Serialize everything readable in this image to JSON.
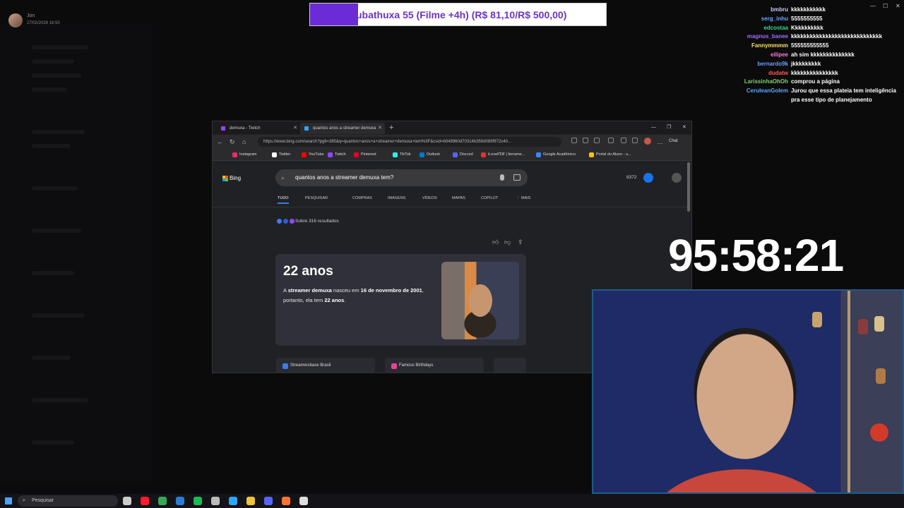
{
  "overlay": {
    "streamer_name": "Jon",
    "datetime": "27/02/2026 16:50",
    "sub_goal": {
      "label": "Subathuxa 55 (Filme +4h) (R$ 81,10/R$ 500,00)",
      "progress_fraction": 0.162,
      "fill_color": "#6b2bd6"
    },
    "timer": "95:58:21"
  },
  "chat": [
    {
      "user": "bmbru",
      "message": "kkkkkkkkkkk",
      "color": "#c7c7ff"
    },
    {
      "user": "serg_inhu",
      "message": "5555555555",
      "color": "#6ea3ff"
    },
    {
      "user": "edcostaa",
      "message": "Kkkkkkkkkk",
      "color": "#3cd48e"
    },
    {
      "user": "magnus_banee",
      "message": "kkkkkkkkkkkkkkkkkkkkkkkkkkkkk",
      "color": "#a06cff"
    },
    {
      "user": "Fannymmmm",
      "message": "555555555555",
      "color": "#ffe066"
    },
    {
      "user": "eilipee",
      "message": "ah sim kkkkkkkkkkkkkk",
      "color": "#ff7ad9"
    },
    {
      "user": "bernardo9k",
      "message": "jkkkkkkkkk",
      "color": "#6aa0ff"
    },
    {
      "user": "dudatw",
      "message": "kkkkkkkkkkkkkkk",
      "color": "#ff5a5a"
    },
    {
      "user": "LarissinhaOhOh",
      "message": "comprou a página",
      "color": "#7ad66a"
    },
    {
      "user": "CeruleanGolem",
      "message": "Jurou que essa plateia tem inteligência pra esse tipo de planejamento",
      "color": "#5aa7ff"
    }
  ],
  "browser": {
    "tabs": [
      {
        "label": "demuxa - Twitch",
        "icon_color": "#9146ff",
        "active": false
      },
      {
        "label": "quantos anos a streamer demuxa",
        "icon_color": "#2aa7ff",
        "active": true
      }
    ],
    "new_tab": "+",
    "url": "https://www.bing.com/search?pglt=385&q=quantos+anos+a+streamer+demuxa+tem%3F&cvid=b048960d70314b359d089f972c40...",
    "chat_button": "Chat",
    "bookmarks": [
      {
        "label": "Instagram",
        "color": "#e1306c"
      },
      {
        "label": "Twitter",
        "color": "#ffffff"
      },
      {
        "label": "YouTube",
        "color": "#ff0000"
      },
      {
        "label": "Twitch",
        "color": "#9146ff"
      },
      {
        "label": "Pinterest",
        "color": "#e60023"
      },
      {
        "label": "TikTok",
        "color": "#25f4ee"
      },
      {
        "label": "Outlook",
        "color": "#0078d4"
      },
      {
        "label": "Discord",
        "color": "#5865f2"
      },
      {
        "label": "iLovePDF | ferrame...",
        "color": "#e5322d"
      },
      {
        "label": "Google Acadêmico",
        "color": "#4285f4"
      },
      {
        "label": "Portal do Aluno - u...",
        "color": "#f4c20d"
      }
    ]
  },
  "bing": {
    "logo": "Bing",
    "query": "quantos anos a streamer demuxa tem?",
    "rewards_points": "8372",
    "scopes": [
      "TUDO",
      "PESQUISAR",
      "COMPRAS",
      "IMAGENS",
      "VÍDEOS",
      "MAPAS",
      "COPILOT",
      "⋮ MAIS"
    ],
    "results_count": "Sobre 316 resultados",
    "answer": {
      "headline": "22 anos",
      "desc_pre": "A ",
      "desc_b1": "streamer demuxa",
      "desc_mid": " nasceu em ",
      "desc_b2": "16 de novembro de 2001",
      "desc_mid2": ", portanto, ela tem ",
      "desc_b3": "22 anos",
      "desc_end": "."
    },
    "sources": [
      {
        "label": "Streamersbase Brasil",
        "color": "#3b7ce8"
      },
      {
        "label": "Famous Birthdays",
        "color": "#e84393"
      }
    ]
  },
  "taskbar": {
    "search_placeholder": "Pesquisar",
    "apps": [
      {
        "name": "task-view",
        "color": "#cccccc"
      },
      {
        "name": "opera",
        "color": "#ff1b2d"
      },
      {
        "name": "chrome",
        "color": "#34a853"
      },
      {
        "name": "app-blue",
        "color": "#2e7bd6"
      },
      {
        "name": "spotify",
        "color": "#1db954"
      },
      {
        "name": "app-gray",
        "color": "#bbbbbb"
      },
      {
        "name": "edge",
        "color": "#2aa7ff"
      },
      {
        "name": "file-explorer",
        "color": "#f0c23b"
      },
      {
        "name": "discord",
        "color": "#5865f2"
      },
      {
        "name": "firefox",
        "color": "#ff7139"
      },
      {
        "name": "obs",
        "color": "#dddddd"
      }
    ]
  }
}
